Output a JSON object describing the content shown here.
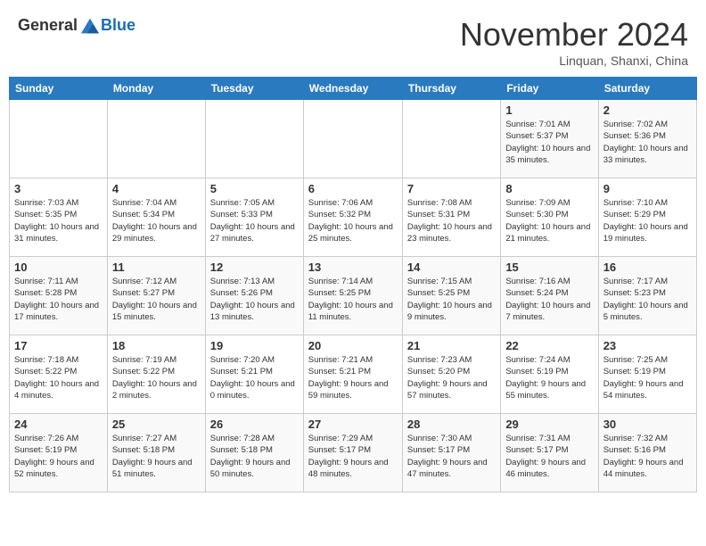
{
  "header": {
    "logo_general": "General",
    "logo_blue": "Blue",
    "month_title": "November 2024",
    "location": "Linquan, Shanxi, China"
  },
  "days_of_week": [
    "Sunday",
    "Monday",
    "Tuesday",
    "Wednesday",
    "Thursday",
    "Friday",
    "Saturday"
  ],
  "weeks": [
    [
      {
        "day": "",
        "detail": ""
      },
      {
        "day": "",
        "detail": ""
      },
      {
        "day": "",
        "detail": ""
      },
      {
        "day": "",
        "detail": ""
      },
      {
        "day": "",
        "detail": ""
      },
      {
        "day": "1",
        "detail": "Sunrise: 7:01 AM\nSunset: 5:37 PM\nDaylight: 10 hours and 35 minutes."
      },
      {
        "day": "2",
        "detail": "Sunrise: 7:02 AM\nSunset: 5:36 PM\nDaylight: 10 hours and 33 minutes."
      }
    ],
    [
      {
        "day": "3",
        "detail": "Sunrise: 7:03 AM\nSunset: 5:35 PM\nDaylight: 10 hours and 31 minutes."
      },
      {
        "day": "4",
        "detail": "Sunrise: 7:04 AM\nSunset: 5:34 PM\nDaylight: 10 hours and 29 minutes."
      },
      {
        "day": "5",
        "detail": "Sunrise: 7:05 AM\nSunset: 5:33 PM\nDaylight: 10 hours and 27 minutes."
      },
      {
        "day": "6",
        "detail": "Sunrise: 7:06 AM\nSunset: 5:32 PM\nDaylight: 10 hours and 25 minutes."
      },
      {
        "day": "7",
        "detail": "Sunrise: 7:08 AM\nSunset: 5:31 PM\nDaylight: 10 hours and 23 minutes."
      },
      {
        "day": "8",
        "detail": "Sunrise: 7:09 AM\nSunset: 5:30 PM\nDaylight: 10 hours and 21 minutes."
      },
      {
        "day": "9",
        "detail": "Sunrise: 7:10 AM\nSunset: 5:29 PM\nDaylight: 10 hours and 19 minutes."
      }
    ],
    [
      {
        "day": "10",
        "detail": "Sunrise: 7:11 AM\nSunset: 5:28 PM\nDaylight: 10 hours and 17 minutes."
      },
      {
        "day": "11",
        "detail": "Sunrise: 7:12 AM\nSunset: 5:27 PM\nDaylight: 10 hours and 15 minutes."
      },
      {
        "day": "12",
        "detail": "Sunrise: 7:13 AM\nSunset: 5:26 PM\nDaylight: 10 hours and 13 minutes."
      },
      {
        "day": "13",
        "detail": "Sunrise: 7:14 AM\nSunset: 5:25 PM\nDaylight: 10 hours and 11 minutes."
      },
      {
        "day": "14",
        "detail": "Sunrise: 7:15 AM\nSunset: 5:25 PM\nDaylight: 10 hours and 9 minutes."
      },
      {
        "day": "15",
        "detail": "Sunrise: 7:16 AM\nSunset: 5:24 PM\nDaylight: 10 hours and 7 minutes."
      },
      {
        "day": "16",
        "detail": "Sunrise: 7:17 AM\nSunset: 5:23 PM\nDaylight: 10 hours and 5 minutes."
      }
    ],
    [
      {
        "day": "17",
        "detail": "Sunrise: 7:18 AM\nSunset: 5:22 PM\nDaylight: 10 hours and 4 minutes."
      },
      {
        "day": "18",
        "detail": "Sunrise: 7:19 AM\nSunset: 5:22 PM\nDaylight: 10 hours and 2 minutes."
      },
      {
        "day": "19",
        "detail": "Sunrise: 7:20 AM\nSunset: 5:21 PM\nDaylight: 10 hours and 0 minutes."
      },
      {
        "day": "20",
        "detail": "Sunrise: 7:21 AM\nSunset: 5:21 PM\nDaylight: 9 hours and 59 minutes."
      },
      {
        "day": "21",
        "detail": "Sunrise: 7:23 AM\nSunset: 5:20 PM\nDaylight: 9 hours and 57 minutes."
      },
      {
        "day": "22",
        "detail": "Sunrise: 7:24 AM\nSunset: 5:19 PM\nDaylight: 9 hours and 55 minutes."
      },
      {
        "day": "23",
        "detail": "Sunrise: 7:25 AM\nSunset: 5:19 PM\nDaylight: 9 hours and 54 minutes."
      }
    ],
    [
      {
        "day": "24",
        "detail": "Sunrise: 7:26 AM\nSunset: 5:19 PM\nDaylight: 9 hours and 52 minutes."
      },
      {
        "day": "25",
        "detail": "Sunrise: 7:27 AM\nSunset: 5:18 PM\nDaylight: 9 hours and 51 minutes."
      },
      {
        "day": "26",
        "detail": "Sunrise: 7:28 AM\nSunset: 5:18 PM\nDaylight: 9 hours and 50 minutes."
      },
      {
        "day": "27",
        "detail": "Sunrise: 7:29 AM\nSunset: 5:17 PM\nDaylight: 9 hours and 48 minutes."
      },
      {
        "day": "28",
        "detail": "Sunrise: 7:30 AM\nSunset: 5:17 PM\nDaylight: 9 hours and 47 minutes."
      },
      {
        "day": "29",
        "detail": "Sunrise: 7:31 AM\nSunset: 5:17 PM\nDaylight: 9 hours and 46 minutes."
      },
      {
        "day": "30",
        "detail": "Sunrise: 7:32 AM\nSunset: 5:16 PM\nDaylight: 9 hours and 44 minutes."
      }
    ]
  ]
}
